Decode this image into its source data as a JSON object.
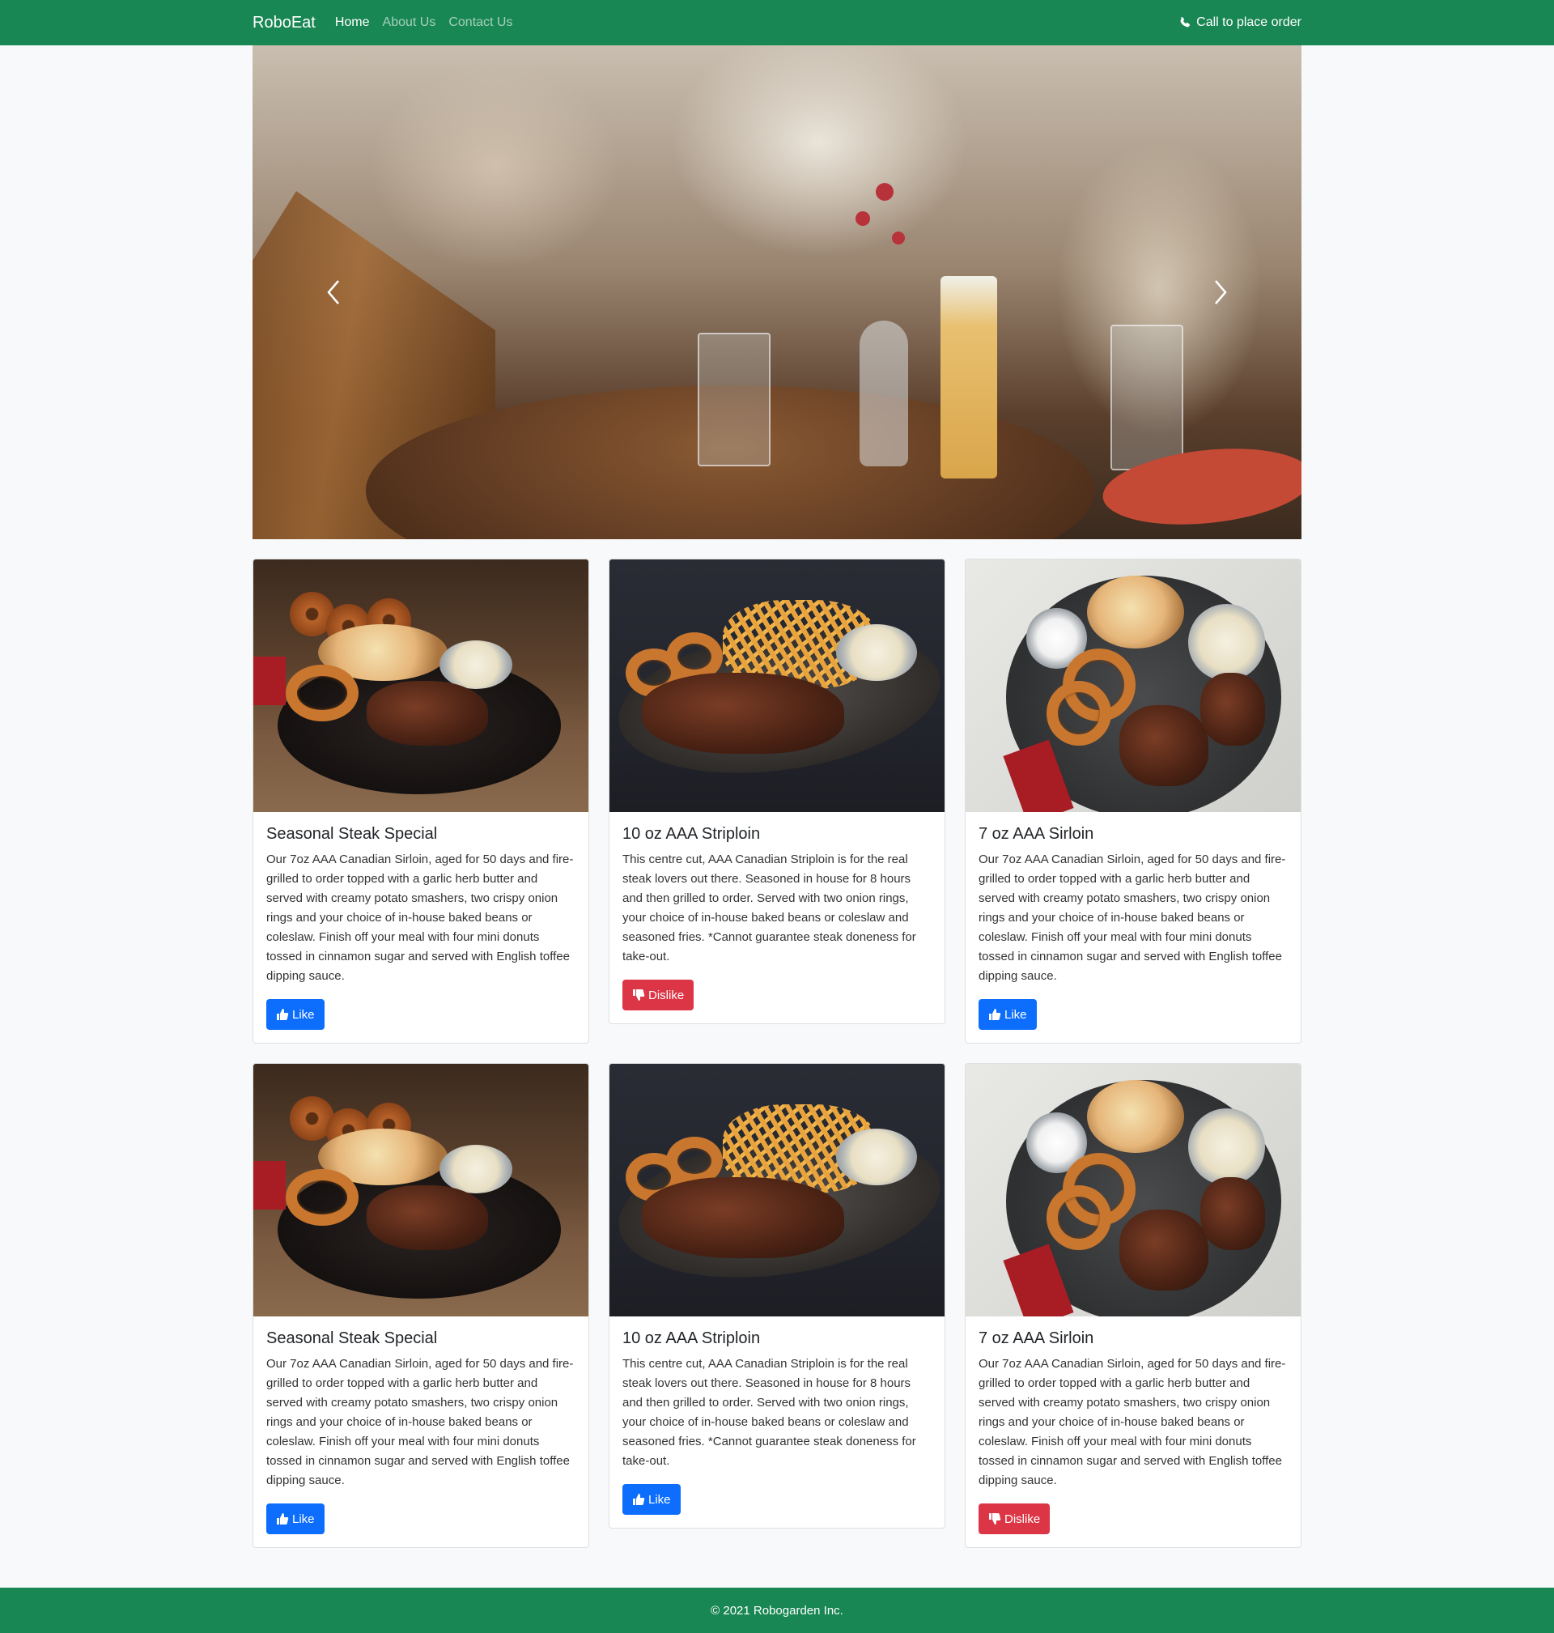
{
  "navbar": {
    "brand": "RoboEat",
    "links": [
      {
        "label": "Home"
      },
      {
        "label": "About Us"
      },
      {
        "label": "Contact Us"
      }
    ],
    "call_text": "Call to place order"
  },
  "icons": {
    "phone": "phone-icon",
    "prev": "chevron-left-icon",
    "next": "chevron-right-icon",
    "like": "thumbs-up-icon",
    "dislike": "thumbs-down-icon"
  },
  "colors": {
    "brand_green": "#198754",
    "like_blue": "#0d6efd",
    "dislike_red": "#dc3545"
  },
  "cards": [
    {
      "title": "Seasonal Steak Special",
      "text": "Our 7oz AAA Canadian Sirloin, aged for 50 days and fire-grilled to order topped with a garlic herb butter and served with creamy potato smashers, two crispy onion rings and your choice of in-house baked beans or coleslaw. Finish off your meal with four mini donuts tossed in cinnamon sugar and served with English toffee dipping sauce.",
      "button": "Like",
      "button_type": "like"
    },
    {
      "title": "10 oz AAA Striploin",
      "text": "This centre cut, AAA Canadian Striploin is for the real steak lovers out there. Seasoned in house for 8 hours and then grilled to order. Served with two onion rings, your choice of in-house baked beans or coleslaw and seasoned fries. *Cannot guarantee steak doneness for take-out.",
      "button": "Dislike",
      "button_type": "dislike"
    },
    {
      "title": "7 oz AAA Sirloin",
      "text": "Our 7oz AAA Canadian Sirloin, aged for 50 days and fire-grilled to order topped with a garlic herb butter and served with creamy potato smashers, two crispy onion rings and your choice of in-house baked beans or coleslaw. Finish off your meal with four mini donuts tossed in cinnamon sugar and served with English toffee dipping sauce.",
      "button": "Like",
      "button_type": "like"
    },
    {
      "title": "Seasonal Steak Special",
      "text": "Our 7oz AAA Canadian Sirloin, aged for 50 days and fire-grilled to order topped with a garlic herb butter and served with creamy potato smashers, two crispy onion rings and your choice of in-house baked beans or coleslaw. Finish off your meal with four mini donuts tossed in cinnamon sugar and served with English toffee dipping sauce.",
      "button": "Like",
      "button_type": "like"
    },
    {
      "title": "10 oz AAA Striploin",
      "text": "This centre cut, AAA Canadian Striploin is for the real steak lovers out there. Seasoned in house for 8 hours and then grilled to order. Served with two onion rings, your choice of in-house baked beans or coleslaw and seasoned fries. *Cannot guarantee steak doneness for take-out.",
      "button": "Like",
      "button_type": "like"
    },
    {
      "title": "7 oz AAA Sirloin",
      "text": "Our 7oz AAA Canadian Sirloin, aged for 50 days and fire-grilled to order topped with a garlic herb butter and served with creamy potato smashers, two crispy onion rings and your choice of in-house baked beans or coleslaw. Finish off your meal with four mini donuts tossed in cinnamon sugar and served with English toffee dipping sauce.",
      "button": "Dislike",
      "button_type": "dislike"
    }
  ],
  "footer": {
    "text": "© 2021 Robogarden Inc."
  }
}
